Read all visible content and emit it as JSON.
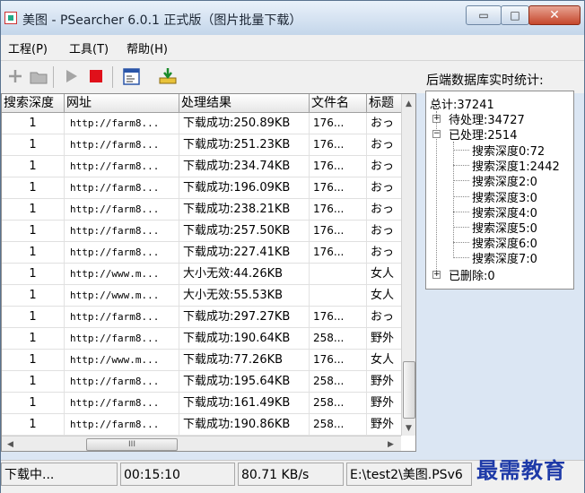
{
  "window": {
    "title": "美图 - PSearcher 6.0.1 正式版（图片批量下载）",
    "min_label": "▭",
    "max_label": "□",
    "close_label": "✕"
  },
  "menu": [
    "工程(P)",
    "工具(T)",
    "帮助(H)"
  ],
  "toolbar": {
    "buttons": [
      "add-icon",
      "open-folder-icon",
      "play-icon",
      "stop-icon",
      "properties-icon",
      "download-icon"
    ]
  },
  "table": {
    "columns": [
      "搜索深度",
      "网址",
      "处理结果",
      "文件名",
      "标题"
    ],
    "rows": [
      {
        "depth": "1",
        "url": "http://farm8...",
        "result": "下载成功:250.89KB",
        "file": "176...",
        "title": "おっ"
      },
      {
        "depth": "1",
        "url": "http://farm8...",
        "result": "下载成功:251.23KB",
        "file": "176...",
        "title": "おっ"
      },
      {
        "depth": "1",
        "url": "http://farm8...",
        "result": "下载成功:234.74KB",
        "file": "176...",
        "title": "おっ"
      },
      {
        "depth": "1",
        "url": "http://farm8...",
        "result": "下载成功:196.09KB",
        "file": "176...",
        "title": "おっ"
      },
      {
        "depth": "1",
        "url": "http://farm8...",
        "result": "下载成功:238.21KB",
        "file": "176...",
        "title": "おっ"
      },
      {
        "depth": "1",
        "url": "http://farm8...",
        "result": "下载成功:257.50KB",
        "file": "176...",
        "title": "おっ"
      },
      {
        "depth": "1",
        "url": "http://farm8...",
        "result": "下载成功:227.41KB",
        "file": "176...",
        "title": "おっ"
      },
      {
        "depth": "1",
        "url": "http://www.m...",
        "result": "大小无效:44.26KB",
        "file": "",
        "title": "女人"
      },
      {
        "depth": "1",
        "url": "http://www.m...",
        "result": "大小无效:55.53KB",
        "file": "",
        "title": "女人"
      },
      {
        "depth": "1",
        "url": "http://farm8...",
        "result": "下载成功:297.27KB",
        "file": "176...",
        "title": "おっ"
      },
      {
        "depth": "1",
        "url": "http://farm8...",
        "result": "下载成功:190.64KB",
        "file": "258...",
        "title": "野外"
      },
      {
        "depth": "1",
        "url": "http://www.m...",
        "result": "下载成功:77.26KB",
        "file": "176...",
        "title": "女人"
      },
      {
        "depth": "1",
        "url": "http://farm8...",
        "result": "下载成功:195.64KB",
        "file": "258...",
        "title": "野外"
      },
      {
        "depth": "1",
        "url": "http://farm8...",
        "result": "下载成功:161.49KB",
        "file": "258...",
        "title": "野外"
      },
      {
        "depth": "1",
        "url": "http://farm8...",
        "result": "下载成功:190.86KB",
        "file": "258...",
        "title": "野外"
      }
    ],
    "hscroll_label": "III"
  },
  "stats": {
    "title": "后端数据库实时统计:",
    "total": "总计:37241",
    "pending": "待处理:34727",
    "processed": "已处理:2514",
    "depths": [
      "搜索深度0:72",
      "搜索深度1:2442",
      "搜索深度2:0",
      "搜索深度3:0",
      "搜索深度4:0",
      "搜索深度5:0",
      "搜索深度6:0",
      "搜索深度7:0"
    ],
    "deleted": "已删除:0"
  },
  "status": {
    "state": "下载中...",
    "elapsed": "00:15:10",
    "speed": "80.71 KB/s",
    "path": "E:\\test2\\美图.PSv6"
  },
  "watermark": "最需教育"
}
